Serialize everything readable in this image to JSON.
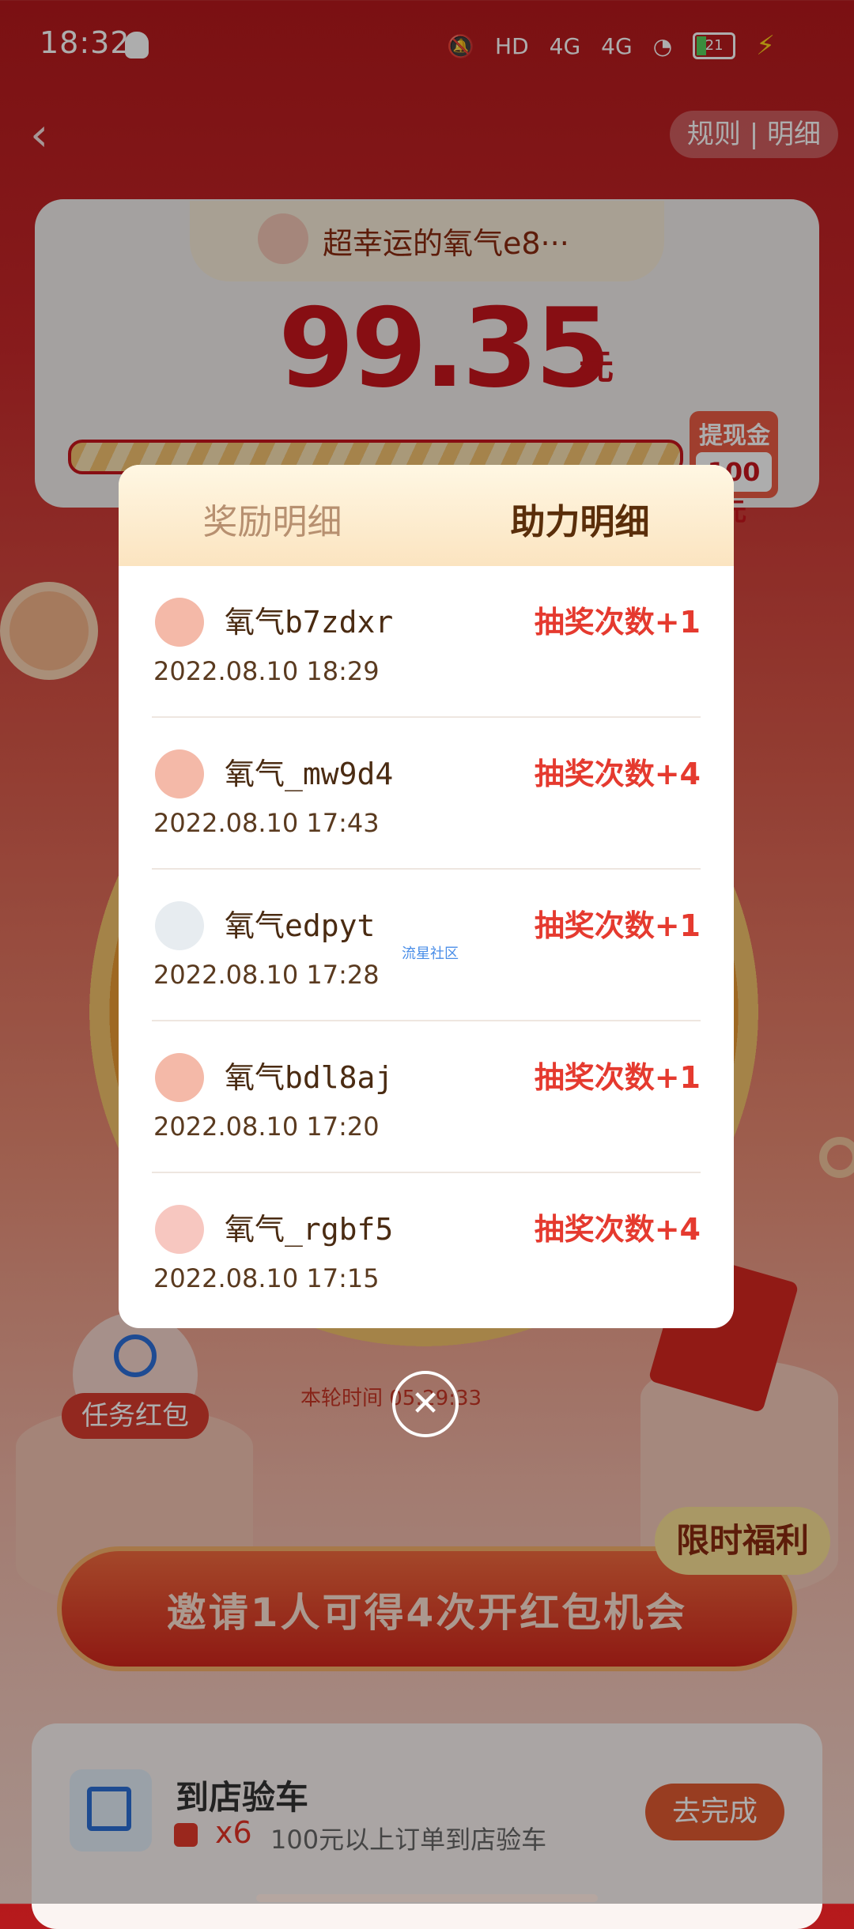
{
  "status_bar": {
    "time": "18:32",
    "network1": "4G",
    "network2": "4G",
    "hd_label": "HD",
    "battery": "21"
  },
  "header": {
    "rules_label": "规则 | 明细"
  },
  "prize_card": {
    "username": "超幸运的氧气e8···",
    "amount": "99.35",
    "unit": "元",
    "withdraw_label": "提现金",
    "withdraw_value": "100元",
    "progress": 0.93
  },
  "background": {
    "task_red_packet_label": "任务红包",
    "countdown": "本轮时间 05:29:33",
    "limited_label": "限时福利",
    "invite_label": "邀请1人可得4次开红包机会",
    "task": {
      "title": "到店验车",
      "count": "x6",
      "desc": "100元以上订单到店验车",
      "button": "去完成"
    }
  },
  "modal": {
    "tabs": [
      "奖励明细",
      "助力明细"
    ],
    "active_tab": 1,
    "rows": [
      {
        "name": "氧气b7zdxr",
        "reward": "抽奖次数+1",
        "date": "2022.08.10 18:29",
        "avatar_color": "#f4b9a8"
      },
      {
        "name": "氧气_mw9d4",
        "reward": "抽奖次数+4",
        "date": "2022.08.10 17:43",
        "avatar_color": "#f4b9a8"
      },
      {
        "name": "氧气edpyt",
        "reward": "抽奖次数+1",
        "date": "2022.08.10 17:28",
        "avatar_color": "#e7ecf0"
      },
      {
        "name": "氧气bdl8aj",
        "reward": "抽奖次数+1",
        "date": "2022.08.10 17:20",
        "avatar_color": "#f4b9a8"
      },
      {
        "name": "氧气_rgbf5",
        "reward": "抽奖次数+4",
        "date": "2022.08.10 17:15",
        "avatar_color": "#f7c7c0"
      }
    ],
    "watermark": "流星社区"
  }
}
